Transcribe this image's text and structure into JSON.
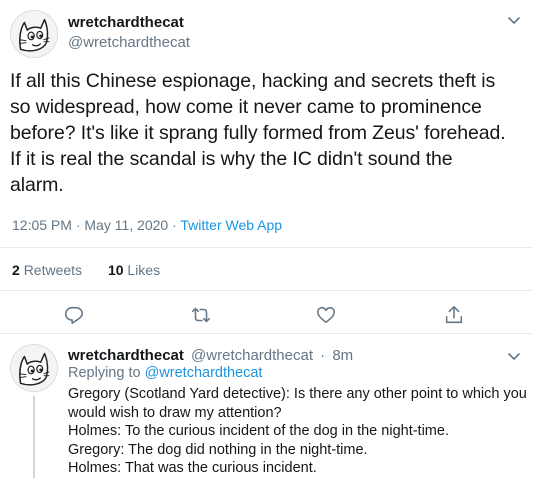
{
  "main_tweet": {
    "author": {
      "display_name": "wretchardthecat",
      "handle": "@wretchardthecat"
    },
    "text_lines": [
      "If all this Chinese espionage, hacking and secrets theft is",
      "so widespread, how come it never came to prominence",
      "before? It's like it sprang fully formed from Zeus' forehead.",
      "If it is real the scandal is why the IC didn't sound the",
      "alarm."
    ],
    "time": "12:05 PM",
    "separator": "·",
    "date": "May 11, 2020",
    "source": "Twitter Web App",
    "retweets": {
      "count": "2",
      "label": "Retweets"
    },
    "likes": {
      "count": "10",
      "label": "Likes"
    }
  },
  "reply_tweet": {
    "author": {
      "display_name": "wretchardthecat",
      "handle": "@wretchardthecat"
    },
    "separator": "·",
    "age": "8m",
    "replying_prefix": "Replying to",
    "replying_to": "@wretchardthecat",
    "text_lines": [
      "Gregory (Scotland Yard detective): Is there any other point to which you",
      "would wish to draw my attention?",
      "Holmes: To the curious incident of the dog in the night-time.",
      "Gregory: The dog did nothing in the night-time.",
      "Holmes: That was the curious incident."
    ]
  },
  "icons": {
    "reply": "reply-icon",
    "retweet": "retweet-icon",
    "like": "like-icon",
    "share": "share-icon",
    "more": "chevron-down-icon"
  },
  "colors": {
    "text": "#14171a",
    "secondary": "#657786",
    "link": "#1b95e0",
    "divider": "#e6ecf0"
  }
}
